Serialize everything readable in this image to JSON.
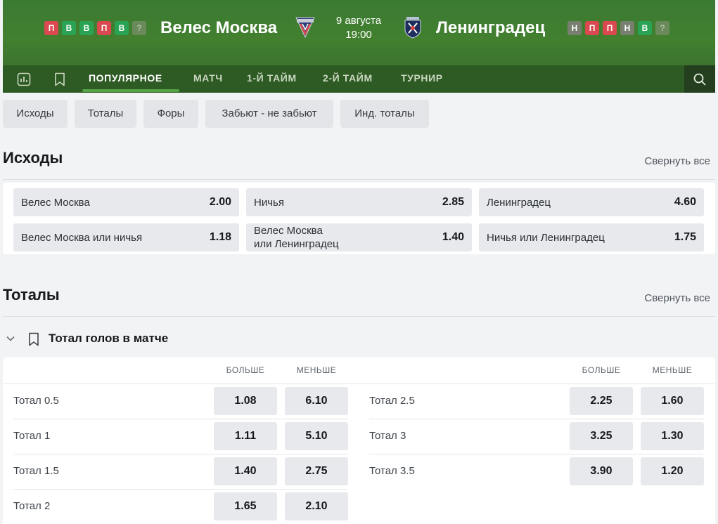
{
  "header": {
    "home": {
      "name": "Велес Москва",
      "form": [
        "П",
        "В",
        "В",
        "П",
        "В",
        "?"
      ]
    },
    "away": {
      "name": "Ленинградец",
      "form": [
        "Н",
        "П",
        "П",
        "Н",
        "В",
        "?"
      ]
    },
    "date": "9 августа",
    "time": "19:00",
    "colors": {
      "header_bg": "#42802f",
      "nav_bg": "#2e5a23",
      "loss": "#d9494f",
      "win": "#2aa454",
      "draw": "#77806f"
    }
  },
  "nav": {
    "icons": [
      "stats-icon",
      "bookmark-icon"
    ],
    "tabs": [
      "ПОПУЛЯРНОЕ",
      "МАТЧ",
      "1-Й ТАЙМ",
      "2-Й ТАЙМ",
      "ТУРНИР"
    ],
    "active_tab": "ПОПУЛЯРНОЕ",
    "search_icon": "search-icon"
  },
  "chips": [
    "Исходы",
    "Тоталы",
    "Форы",
    "Забьют - не забьют",
    "Инд. тоталы"
  ],
  "outcomes": {
    "title": "Исходы",
    "collapse_label": "Свернуть все",
    "rows": [
      [
        {
          "label": "Велес Москва",
          "odd": "2.00"
        },
        {
          "label": "Ничья",
          "odd": "2.85"
        },
        {
          "label": "Ленинградец",
          "odd": "4.60"
        }
      ],
      [
        {
          "label": "Велес Москва или ничья",
          "odd": "1.18"
        },
        {
          "label": "Велес Москва\nили Ленинградец",
          "odd": "1.40"
        },
        {
          "label": "Ничья или Ленинградец",
          "odd": "1.75"
        }
      ]
    ]
  },
  "totals": {
    "title": "Тоталы",
    "collapse_label": "Свернуть все",
    "market": {
      "title": "Тотал голов в матче",
      "col_over": "БОЛЬШЕ",
      "col_under": "МЕНЬШЕ",
      "left": [
        {
          "label": "Тотал 0.5",
          "over": "1.08",
          "under": "6.10"
        },
        {
          "label": "Тотал 1",
          "over": "1.11",
          "under": "5.10"
        },
        {
          "label": "Тотал 1.5",
          "over": "1.40",
          "under": "2.75"
        },
        {
          "label": "Тотал 2",
          "over": "1.65",
          "under": "2.10"
        }
      ],
      "right": [
        {
          "label": "Тотал 2.5",
          "over": "2.25",
          "under": "1.60"
        },
        {
          "label": "Тотал 3",
          "over": "3.25",
          "under": "1.30"
        },
        {
          "label": "Тотал 3.5",
          "over": "3.90",
          "under": "1.20"
        }
      ]
    }
  }
}
